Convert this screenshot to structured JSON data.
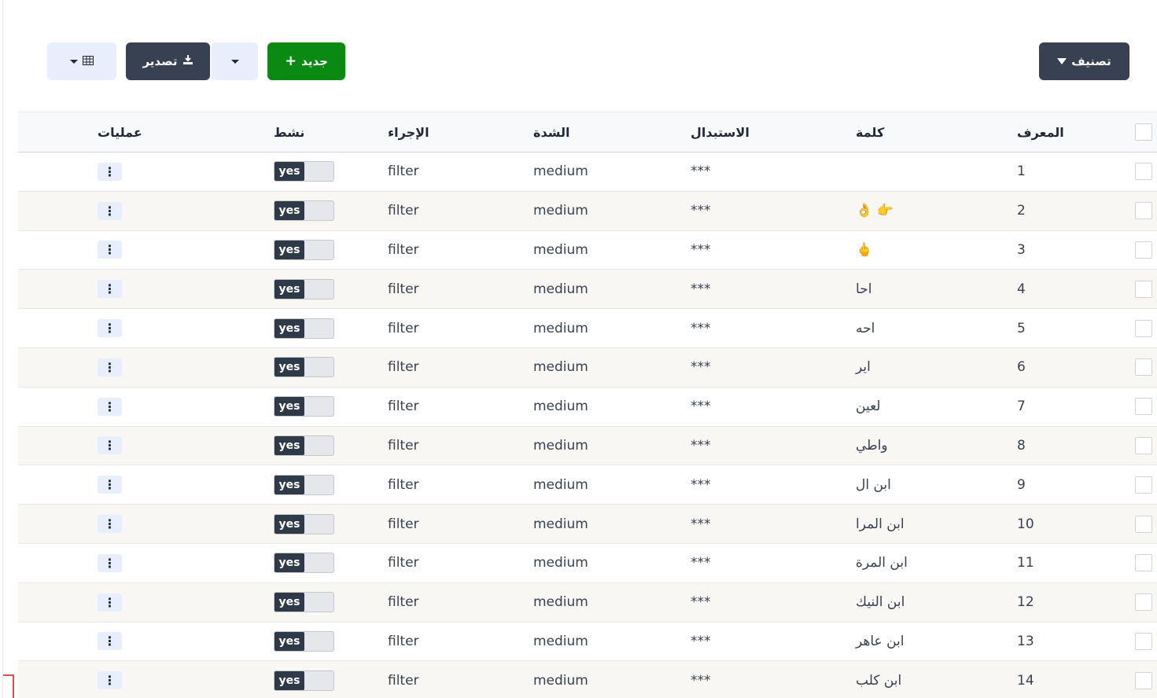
{
  "toolbar": {
    "filter_label": "تصنيف",
    "new_label": "جديد",
    "export_label": "تصدير"
  },
  "icons": {
    "filter": "filter-icon",
    "plus": "plus-icon",
    "download": "download-icon",
    "grid": "grid-icon",
    "caret": "caret-down-icon",
    "kebab": "kebab-icon"
  },
  "colors": {
    "new_button": "#0b8a13",
    "dark_button": "#374151",
    "light_button": "#e8eefc"
  },
  "table": {
    "columns": [
      "المعرف",
      "كلمة",
      "الاستبدال",
      "الشدة",
      "الإجراء",
      "نشط",
      "عمليات"
    ],
    "rows": [
      {
        "id": "1",
        "word": "",
        "replacement": "***",
        "severity": "medium",
        "action": "filter",
        "active": "yes"
      },
      {
        "id": "2",
        "word": "👉 👌",
        "replacement": "***",
        "severity": "medium",
        "action": "filter",
        "active": "yes"
      },
      {
        "id": "3",
        "word": "🖕",
        "replacement": "***",
        "severity": "medium",
        "action": "filter",
        "active": "yes"
      },
      {
        "id": "4",
        "word": "احا",
        "replacement": "***",
        "severity": "medium",
        "action": "filter",
        "active": "yes"
      },
      {
        "id": "5",
        "word": "احه",
        "replacement": "***",
        "severity": "medium",
        "action": "filter",
        "active": "yes"
      },
      {
        "id": "6",
        "word": "اير",
        "replacement": "***",
        "severity": "medium",
        "action": "filter",
        "active": "yes"
      },
      {
        "id": "7",
        "word": "لعين",
        "replacement": "***",
        "severity": "medium",
        "action": "filter",
        "active": "yes"
      },
      {
        "id": "8",
        "word": "واطي",
        "replacement": "***",
        "severity": "medium",
        "action": "filter",
        "active": "yes"
      },
      {
        "id": "9",
        "word": "ابن ال",
        "replacement": "***",
        "severity": "medium",
        "action": "filter",
        "active": "yes"
      },
      {
        "id": "10",
        "word": "ابن المرا",
        "replacement": "***",
        "severity": "medium",
        "action": "filter",
        "active": "yes"
      },
      {
        "id": "11",
        "word": "ابن المرة",
        "replacement": "***",
        "severity": "medium",
        "action": "filter",
        "active": "yes"
      },
      {
        "id": "12",
        "word": "ابن النيك",
        "replacement": "***",
        "severity": "medium",
        "action": "filter",
        "active": "yes"
      },
      {
        "id": "13",
        "word": "ابن عاهر",
        "replacement": "***",
        "severity": "medium",
        "action": "filter",
        "active": "yes"
      },
      {
        "id": "14",
        "word": "ابن كلب",
        "replacement": "***",
        "severity": "medium",
        "action": "filter",
        "active": "yes"
      }
    ]
  }
}
